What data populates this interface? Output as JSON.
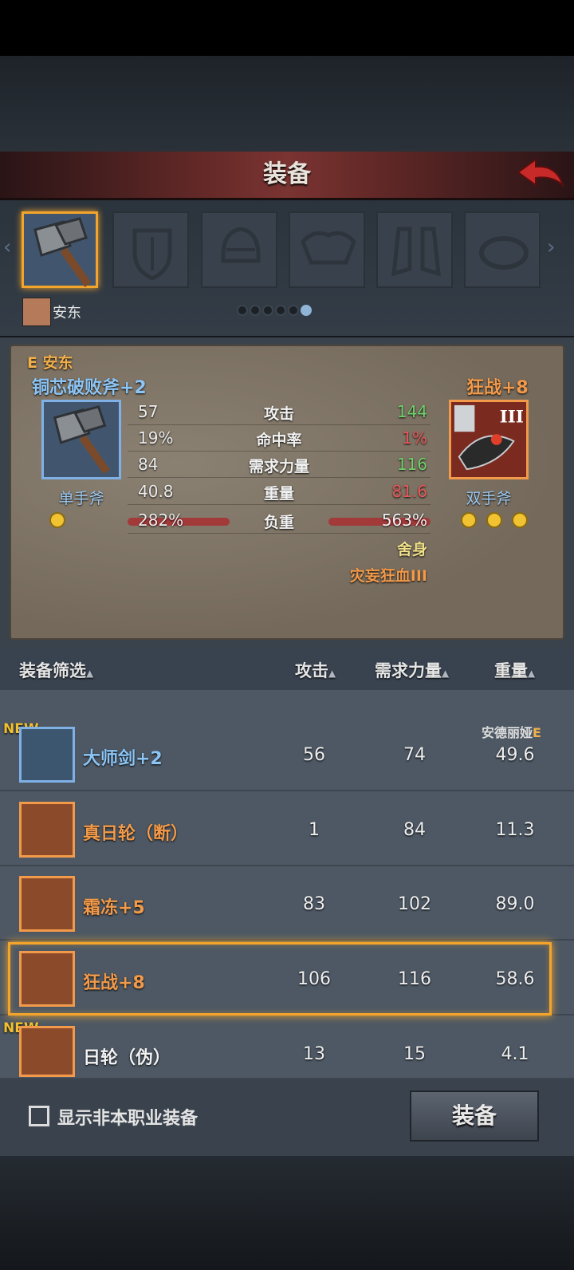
{
  "header": {
    "title": "装备",
    "back_icon": "back-arrow-icon"
  },
  "slots": [
    {
      "icon": "axe-icon",
      "active": true
    },
    {
      "icon": "shield-icon"
    },
    {
      "icon": "helmet-icon"
    },
    {
      "icon": "armor-icon"
    },
    {
      "icon": "boots-icon"
    },
    {
      "icon": "ring-icon"
    }
  ],
  "owner": {
    "name": "安东"
  },
  "pagination": {
    "pages": 6,
    "active": 6
  },
  "compare": {
    "owner_label": "E 安东",
    "current": {
      "name": "铜芯破败斧+2",
      "type": "单手斧",
      "gems": 1
    },
    "candidate": {
      "name": "狂战+8",
      "type": "双手斧",
      "gems": 3,
      "tier": "III"
    },
    "stats": [
      {
        "label": "攻击",
        "current": "57",
        "candidate": "144",
        "tone": "green"
      },
      {
        "label": "命中率",
        "current": "19%",
        "candidate": "1%",
        "tone": "red"
      },
      {
        "label": "需求力量",
        "current": "84",
        "candidate": "116",
        "tone": "green"
      },
      {
        "label": "重量",
        "current": "40.8",
        "candidate": "81.6",
        "tone": "red"
      },
      {
        "label": "负重",
        "current": "282%",
        "candidate": "563%",
        "tone": "white"
      }
    ],
    "extra1": "舍身",
    "extra2": "灾妄狂血III"
  },
  "list": {
    "headers": {
      "filter": "装备筛选",
      "attack": "攻击",
      "strength": "需求力量",
      "weight": "重量"
    },
    "rows": [
      {
        "name": "大师剑+2",
        "attack": "56",
        "strength": "74",
        "weight": "49.6",
        "color": "#8cc4f4",
        "frame": "blue",
        "new": "NEW",
        "owner": "安德丽娅",
        "owner_tag": "E"
      },
      {
        "name": "真日轮（断）",
        "attack": "1",
        "strength": "84",
        "weight": "11.3",
        "color": "#f29a4a",
        "frame": "orange"
      },
      {
        "name": "霜冻+5",
        "attack": "83",
        "strength": "102",
        "weight": "89.0",
        "color": "#f29a4a",
        "frame": "orange"
      },
      {
        "name": "狂战+8",
        "attack": "106",
        "strength": "116",
        "weight": "58.6",
        "color": "#f29a4a",
        "frame": "orange",
        "selected": true
      },
      {
        "name": "日轮（伪）",
        "attack": "13",
        "strength": "15",
        "weight": "4.1",
        "color": "#f2f2f2",
        "frame": "orange",
        "new": "NEW"
      }
    ]
  },
  "footer": {
    "checkbox_label": "显示非本职业装备",
    "equip_label": "装备"
  }
}
